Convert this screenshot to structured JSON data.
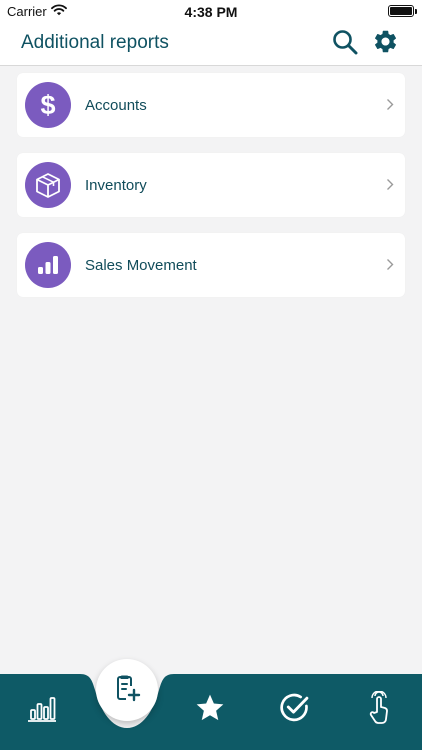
{
  "status_bar": {
    "carrier": "Carrier",
    "time": "4:38 PM"
  },
  "header": {
    "title": "Additional reports",
    "search_icon": "search-icon",
    "settings_icon": "gear-icon"
  },
  "reports": [
    {
      "label": "Accounts",
      "icon": "dollar-icon"
    },
    {
      "label": "Inventory",
      "icon": "box-icon"
    },
    {
      "label": "Sales Movement",
      "icon": "bar-chart-icon"
    }
  ],
  "tab_bar": {
    "items": [
      "bar-chart-tab-icon",
      "document-add-icon",
      "star-icon",
      "check-circle-icon",
      "hand-pointer-icon"
    ],
    "active": "document-add-icon"
  },
  "colors": {
    "accent": "#0f5262",
    "icon_circle": "#7b5bbf",
    "background": "#f3f3f4"
  }
}
